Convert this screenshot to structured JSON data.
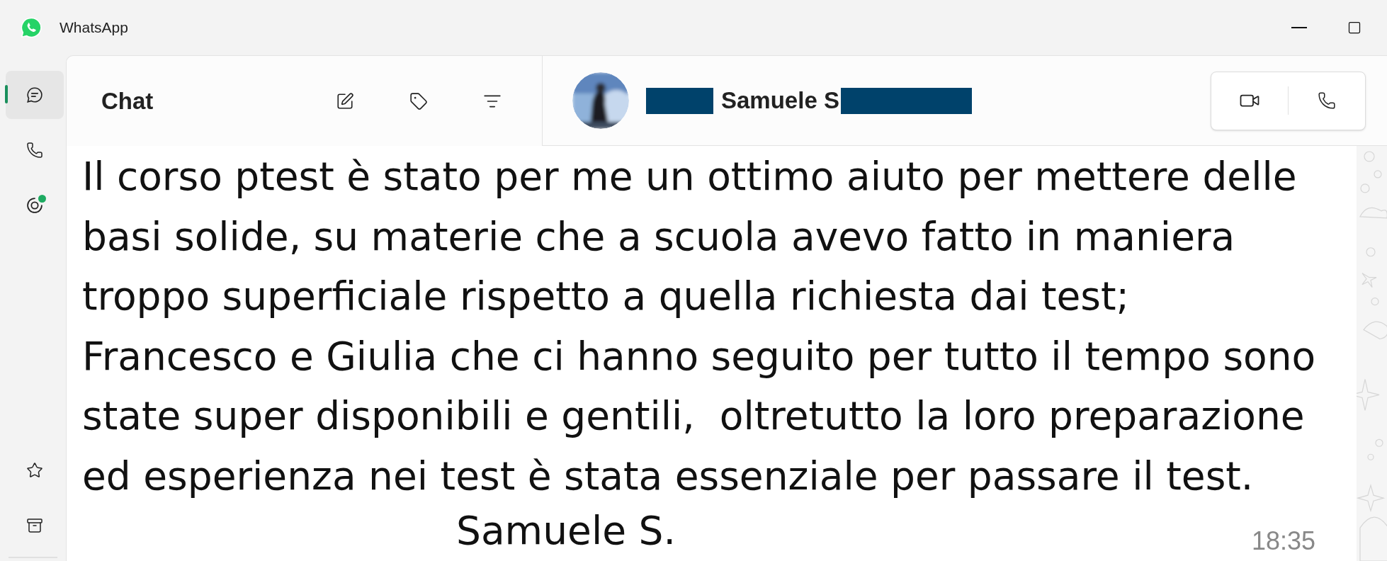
{
  "window": {
    "title": "WhatsApp"
  },
  "rail": {
    "top": [
      {
        "kind": "chats",
        "selected": true
      },
      {
        "kind": "calls",
        "selected": false
      },
      {
        "kind": "status",
        "selected": false,
        "badge": true
      }
    ],
    "bottom": [
      {
        "kind": "starred",
        "selected": false
      },
      {
        "kind": "archived",
        "selected": false
      }
    ]
  },
  "chat_list": {
    "title": "Chat"
  },
  "chat_header": {
    "name": "Samuele S",
    "redacted_before": true,
    "redacted_after": true
  },
  "message": {
    "lines": [
      "Il corso ptest è stato per me un ottimo aiuto per mettere delle",
      "basi solide, su materie che a scuola avevo fatto in maniera",
      "troppo superficiale rispetto a quella richiesta dai test;",
      "Francesco e Giulia che ci hanno seguito per tutto il tempo sono",
      "state super disponibili e gentili,  oltretutto la loro preparazione",
      "ed esperienza nei test è stata essenziale per passare il test."
    ],
    "signature": "Samuele S.",
    "time": "18:35"
  }
}
